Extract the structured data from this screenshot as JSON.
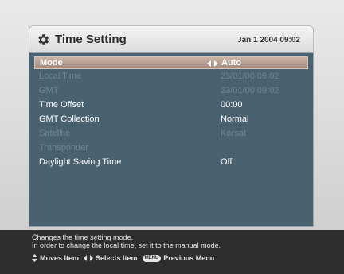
{
  "header": {
    "title": "Time Setting",
    "icon": "gear-icon",
    "datetime": "Jan 1 2004 09:02"
  },
  "settings": [
    {
      "label": "Mode",
      "value": "Auto",
      "state": "selected"
    },
    {
      "label": "Local Time",
      "value": "23/01/00 09:02",
      "state": "disabled"
    },
    {
      "label": "GMT",
      "value": "23/01/00 09:02",
      "state": "disabled"
    },
    {
      "label": "Time Offset",
      "value": "00:00",
      "state": "enabled"
    },
    {
      "label": "GMT Collection",
      "value": "Normal",
      "state": "enabled"
    },
    {
      "label": "Satellite",
      "value": "Korsat",
      "state": "disabled"
    },
    {
      "label": "Transponder",
      "value": "",
      "state": "disabled"
    },
    {
      "label": "Daylight Saving Time",
      "value": "Off",
      "state": "enabled"
    }
  ],
  "footer": {
    "description_line1": "Changes the time setting mode.",
    "description_line2": "In order to change the local time, set it to the manual mode.",
    "help_moves": "Moves Item",
    "help_selects": "Selects Item",
    "menu_key": "MENU",
    "help_previous": "Previous Menu"
  },
  "colors": {
    "list_background": "#4a6270",
    "selected_row": "#b89a8c",
    "disabled_text": "#6e8694",
    "footer_background": "#2e2e2e"
  }
}
